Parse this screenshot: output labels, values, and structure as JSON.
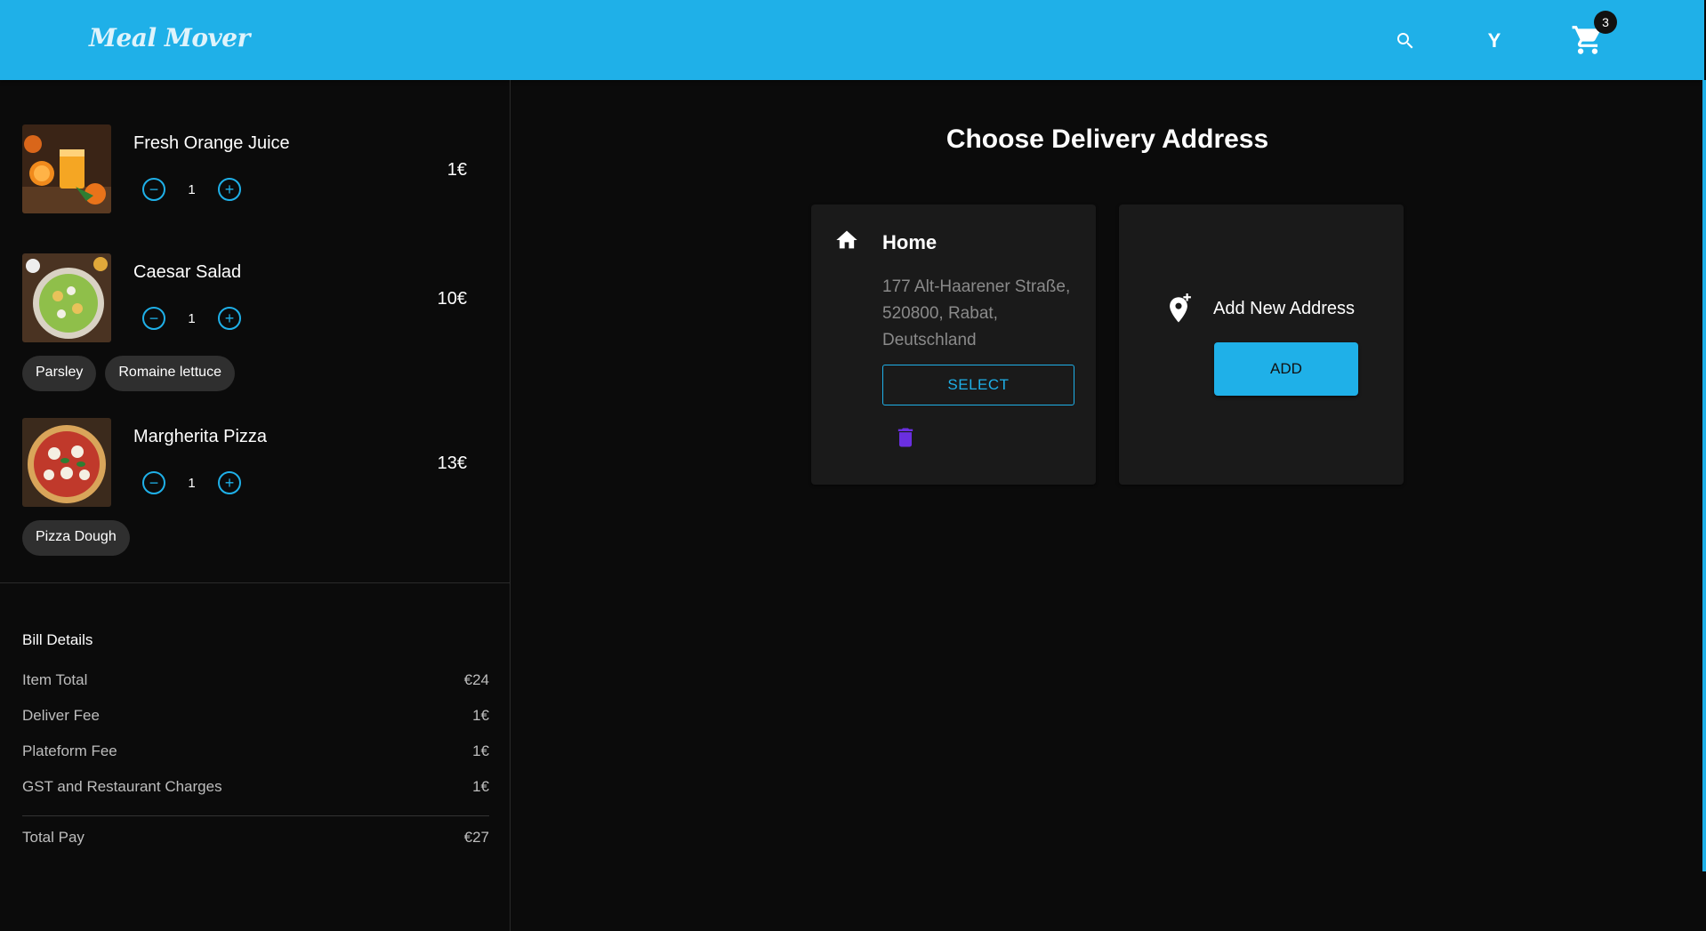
{
  "header": {
    "logo": "Meal Mover",
    "search_icon": "search-icon",
    "avatar_letter": "Y",
    "cart_icon": "cart-icon",
    "cart_count": "3",
    "accent": "#1fb0e8"
  },
  "cart": {
    "items": [
      {
        "name": "Fresh Orange Juice",
        "qty": "1",
        "price": "1€",
        "image": "orange-juice-image",
        "chips": []
      },
      {
        "name": "Caesar Salad",
        "qty": "1",
        "price": "10€",
        "image": "caesar-salad-image",
        "chips": [
          "Parsley",
          "Romaine lettuce"
        ]
      },
      {
        "name": "Margherita Pizza",
        "qty": "1",
        "price": "13€",
        "image": "margherita-pizza-image",
        "chips": [
          "Pizza Dough"
        ]
      }
    ]
  },
  "bill": {
    "title": "Bill Details",
    "rows": [
      {
        "label": "Item Total",
        "value": "€24"
      },
      {
        "label": "Deliver Fee",
        "value": "1€"
      },
      {
        "label": "Plateform Fee",
        "value": "1€"
      },
      {
        "label": "GST and Restaurant Charges",
        "value": "1€"
      }
    ],
    "total_label": "Total Pay",
    "total_value": "€27"
  },
  "main": {
    "title": "Choose Delivery Address",
    "addresses": [
      {
        "label": "Home",
        "address": "177 Alt-Haarener Straße, 520800, Rabat, Deutschland",
        "select_label": "SELECT"
      }
    ],
    "new_address": {
      "label": "Add New Address",
      "button_label": "ADD"
    }
  }
}
